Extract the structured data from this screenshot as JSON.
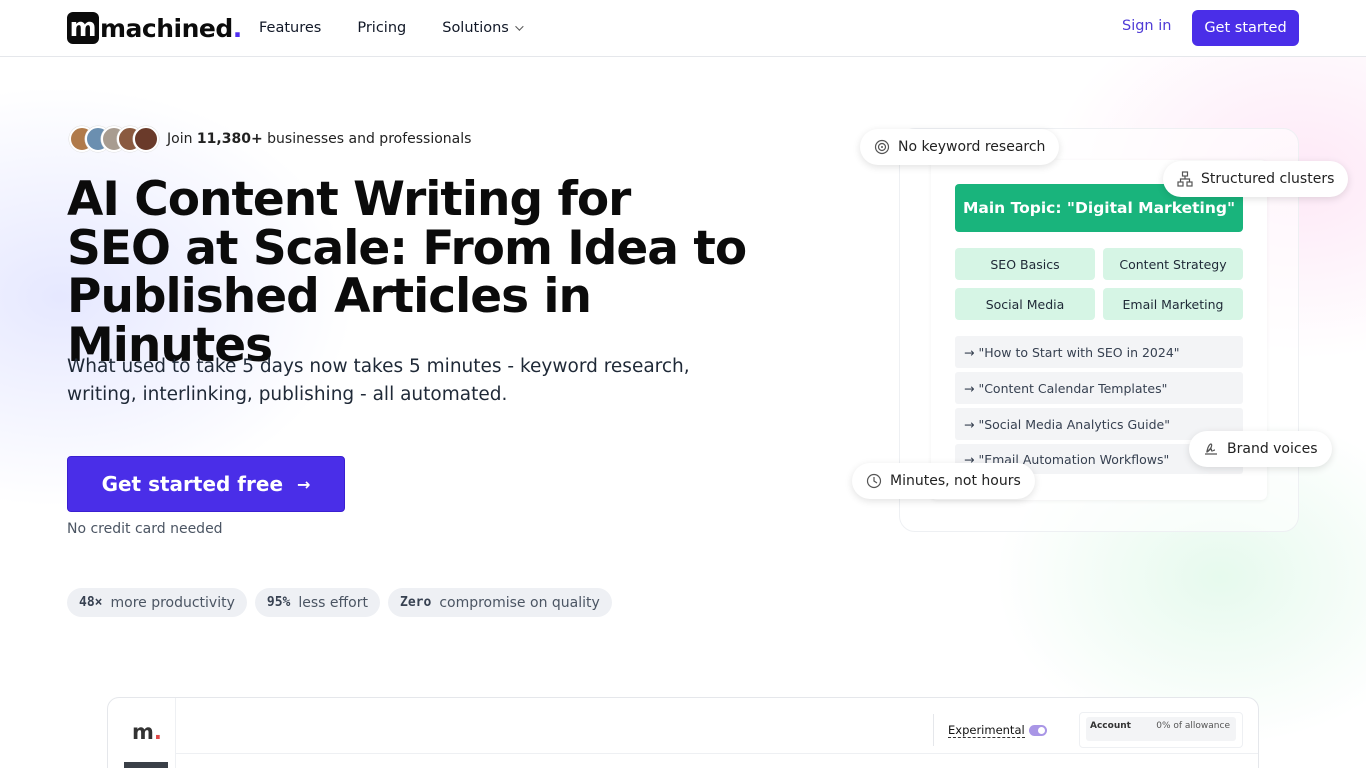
{
  "header": {
    "logo_text": "machined",
    "logo_mark": "m",
    "logo_dot": ".",
    "nav": [
      "Features",
      "Pricing",
      "Solutions"
    ],
    "signin": "Sign in",
    "get_started": "Get started"
  },
  "hero": {
    "join_prefix": "Join",
    "join_count": "11,380+",
    "join_suffix": "businesses and professionals",
    "title_line1": "AI Content Writing for",
    "title_line2": "SEO at Scale: From Idea to",
    "title_line3": "Published Articles in Minutes",
    "subtitle": "What used to take 5 days now takes 5 minutes - keyword research, writing, interlinking, publishing - all automated.",
    "cta": "Get started free",
    "cta_icon": "arrow-right-icon",
    "no_card": "No credit card needed",
    "stats": [
      {
        "value": "48×",
        "label": "more productivity"
      },
      {
        "value": "95%",
        "label": "less effort"
      },
      {
        "value": "Zero",
        "label": "compromise on quality"
      }
    ],
    "avatar_colors": [
      "#b07a4a",
      "#6b8fb0",
      "#9a8f86",
      "#8a5a40",
      "#6a3a2a"
    ]
  },
  "illustration": {
    "main_topic": "Main Topic: \"Digital Marketing\"",
    "subtopics": [
      "SEO Basics",
      "Content Strategy",
      "Social Media",
      "Email Marketing"
    ],
    "articles": [
      "→ \"How to Start with SEO in 2024\"",
      "→ \"Content Calendar Templates\"",
      "→ \"Social Media Analytics Guide\"",
      "→ \"Email Automation Workflows\""
    ],
    "chips": {
      "no_keyword": "No keyword research",
      "structured": "Structured clusters",
      "brand_voices": "Brand voices",
      "minutes": "Minutes, not hours"
    },
    "colors": {
      "accent_green": "#19b47c",
      "light_green": "#d6f5e5",
      "brand_purple": "#4a2ee8"
    }
  },
  "app_preview": {
    "logo": "m",
    "logo_dot": ".",
    "experimental": "Experimental",
    "account_label": "Account",
    "account_allowance": "0% of allowance"
  }
}
